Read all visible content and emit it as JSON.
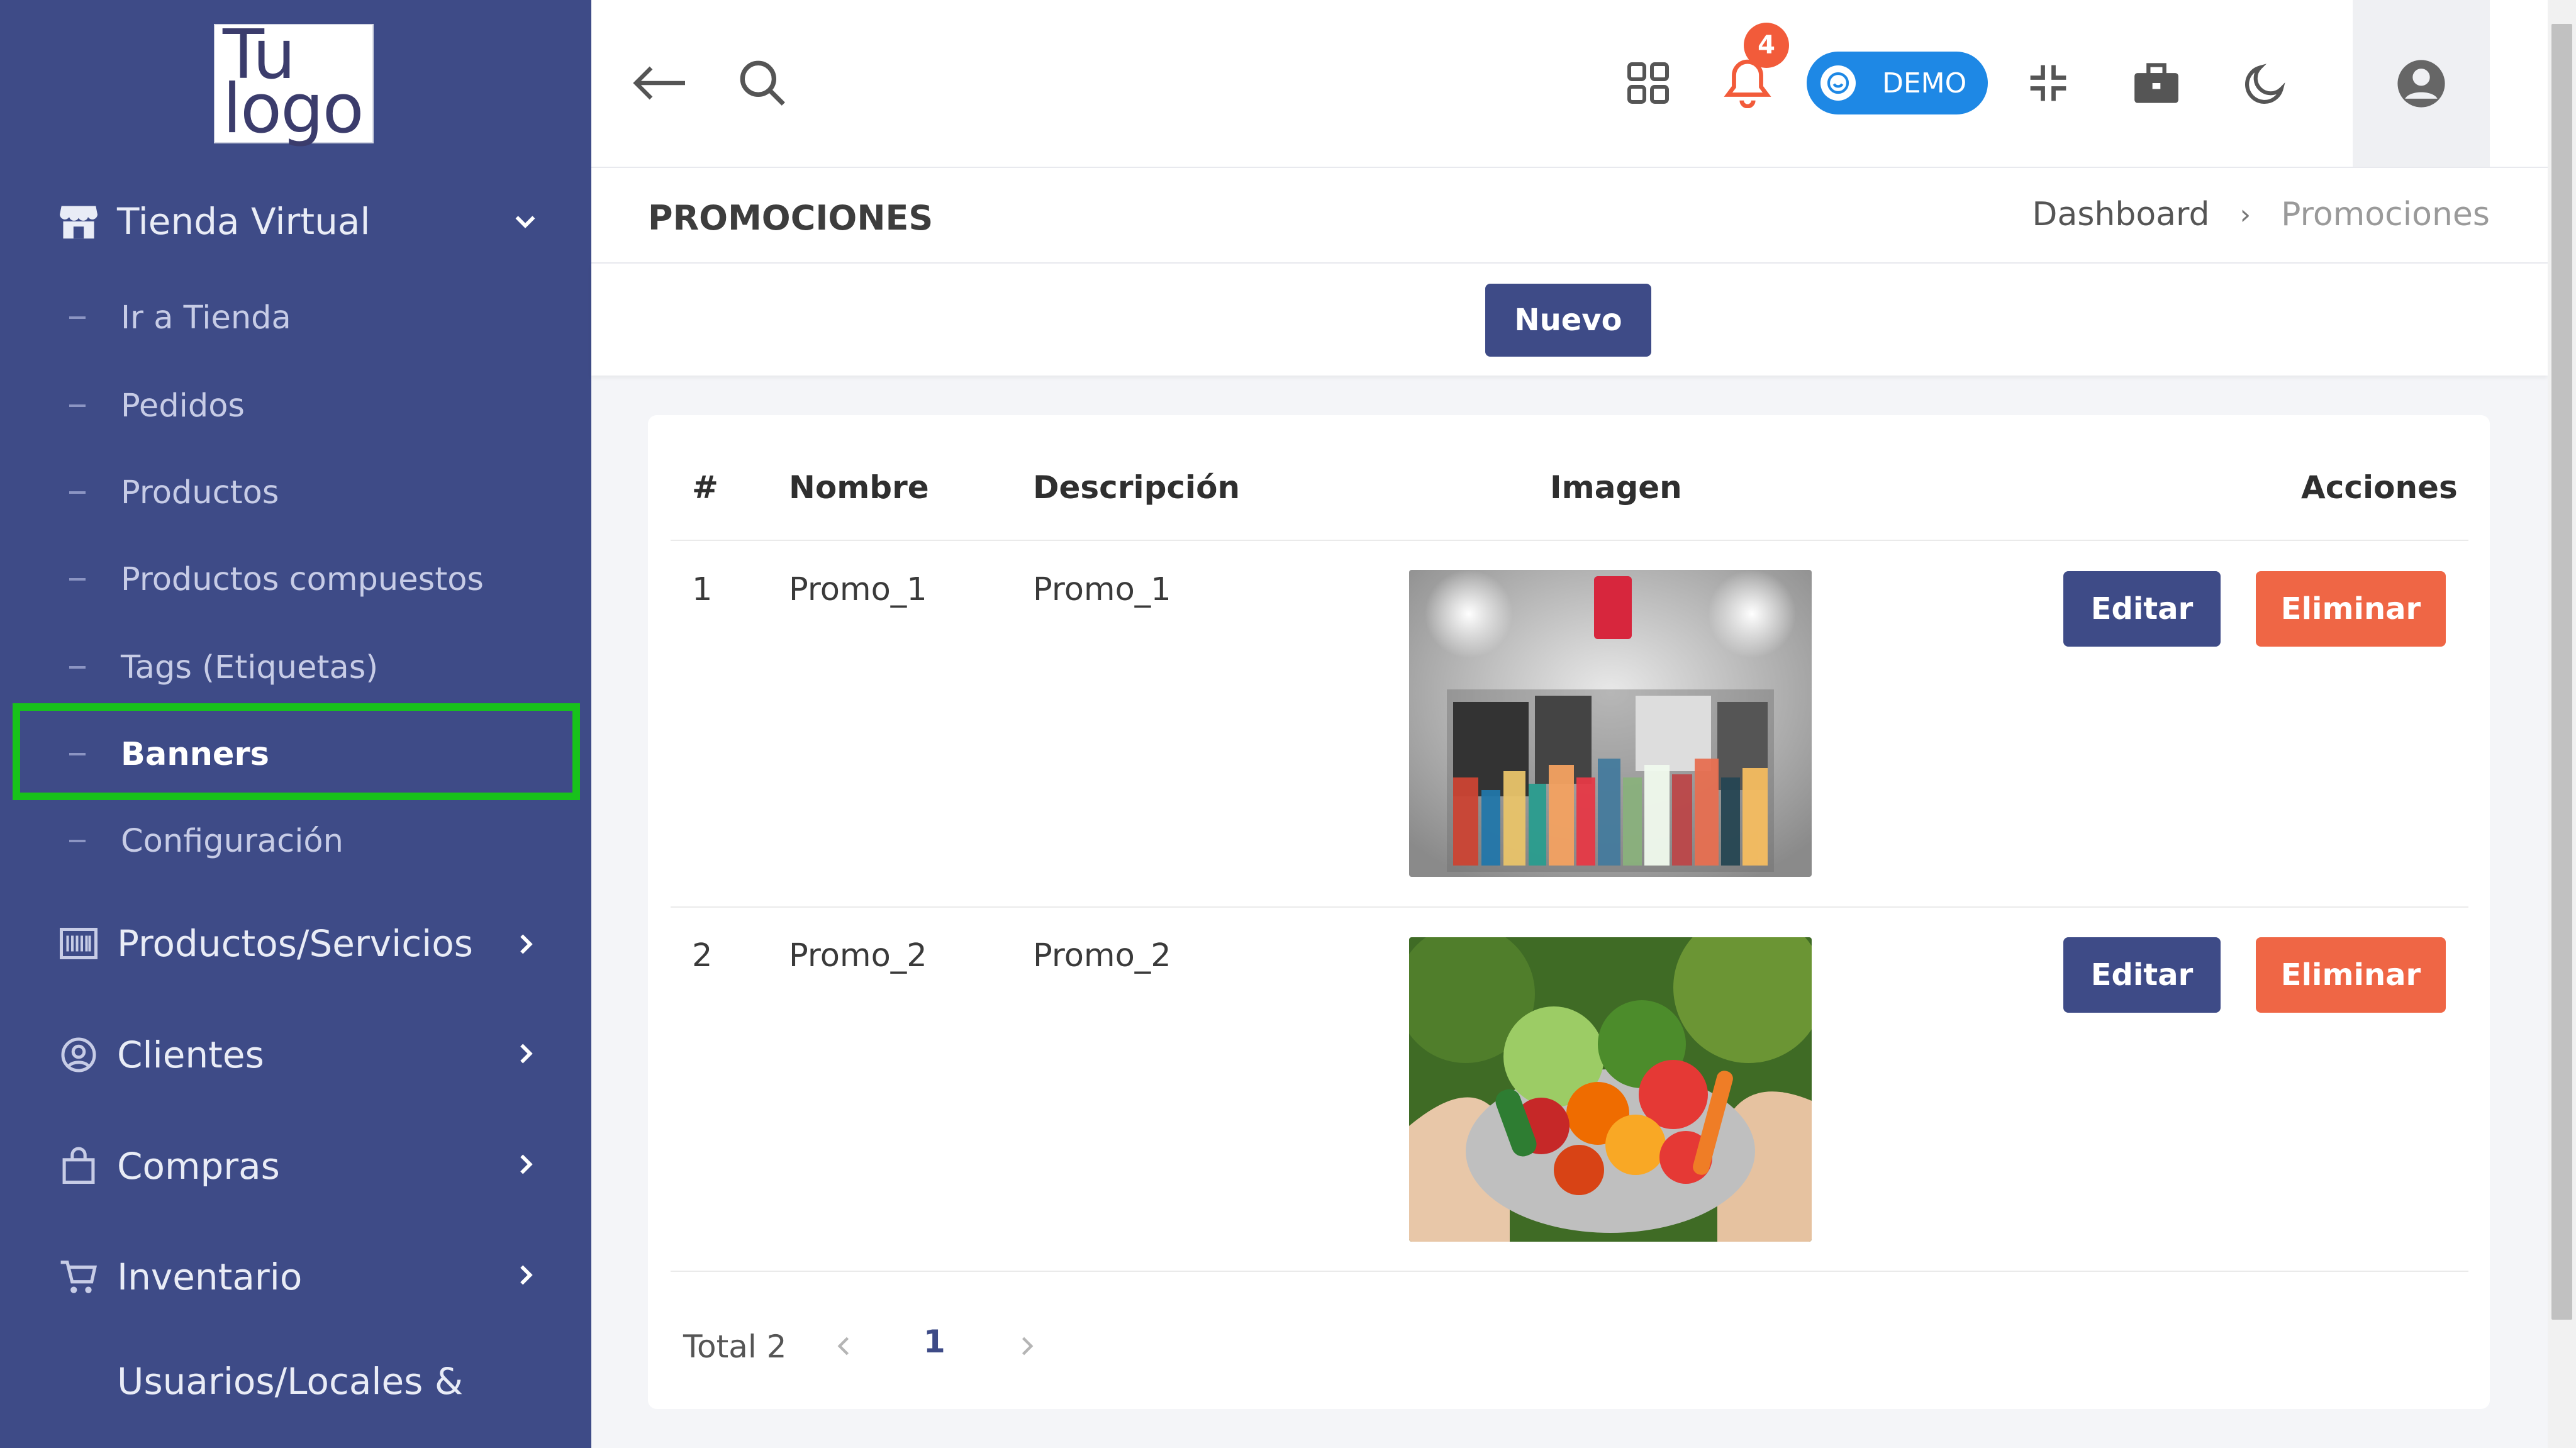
{
  "sidebar": {
    "logo_line1": "Tu",
    "logo_line2": "logo",
    "section": {
      "label": "Tienda Virtual",
      "icon": "store-icon"
    },
    "sub_items": [
      {
        "label": "Ir a Tienda"
      },
      {
        "label": "Pedidos"
      },
      {
        "label": "Productos"
      },
      {
        "label": "Productos compuestos"
      },
      {
        "label": "Tags (Etiquetas)"
      },
      {
        "label": "Banners",
        "active": true
      },
      {
        "label": "Configuración"
      }
    ],
    "groups": [
      {
        "label": "Productos/Servicios",
        "icon": "barcode-icon"
      },
      {
        "label": "Clientes",
        "icon": "user-circle-icon"
      },
      {
        "label": "Compras",
        "icon": "shopping-bag-icon"
      },
      {
        "label": "Inventario",
        "icon": "cart-icon"
      },
      {
        "label": "Usuarios/Locales &",
        "icon": ""
      }
    ]
  },
  "topbar": {
    "notifications_count": "4",
    "demo_label": "DEMO",
    "icons": [
      "back-arrow-icon",
      "search-icon",
      "apps-grid-icon",
      "bell-icon",
      "compress-icon",
      "briefcase-icon",
      "moon-icon",
      "user-avatar-icon"
    ]
  },
  "page": {
    "title": "PROMOCIONES",
    "breadcrumb": [
      "Dashboard",
      "›",
      "Promociones"
    ],
    "new_button": "Nuevo"
  },
  "table": {
    "headers": [
      "#",
      "Nombre",
      "Descripción",
      "Imagen",
      "Acciones"
    ],
    "rows": [
      {
        "num": "1",
        "name": "Promo_1",
        "desc": "Promo_1",
        "image": "products-banner"
      },
      {
        "num": "2",
        "name": "Promo_2",
        "desc": "Promo_2",
        "image": "vegetables-basket"
      }
    ],
    "edit_label": "Editar",
    "delete_label": "Eliminar"
  },
  "pagination": {
    "total": "Total 2",
    "current_page": "1"
  },
  "colors": {
    "sidebar": "#3e4b87",
    "primary": "#3e4b87",
    "danger": "#ef6645",
    "highlight": "#18c21b",
    "badge": "#f25b3a",
    "demo": "#1e88e5"
  }
}
